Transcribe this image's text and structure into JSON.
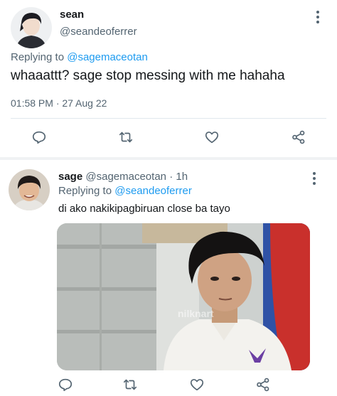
{
  "main_tweet": {
    "display_name": "sean",
    "handle": "@seandeoferrer",
    "replying_label": "Replying to",
    "replying_handle": "@sagemaceotan",
    "text": "whaaattt? sage stop messing with me hahaha",
    "timestamp": "01:58 PM · 27 Aug 22",
    "actions": [
      "reply-icon",
      "retweet-icon",
      "like-icon",
      "share-icon"
    ]
  },
  "reply_tweet": {
    "display_name": "sage",
    "handle": "@sagemaceotan",
    "time": "· 1h",
    "replying_label": "Replying to",
    "replying_handle": "@seandeoferrer",
    "text": "di ako nakikipagbiruan close ba tayo",
    "watermark": "nilknart",
    "actions": [
      "reply-icon",
      "retweet-icon",
      "like-icon",
      "share-icon"
    ]
  },
  "colors": {
    "link": "#1d9bf0",
    "secondary_text": "#536471",
    "divider": "#e1e8ed"
  }
}
